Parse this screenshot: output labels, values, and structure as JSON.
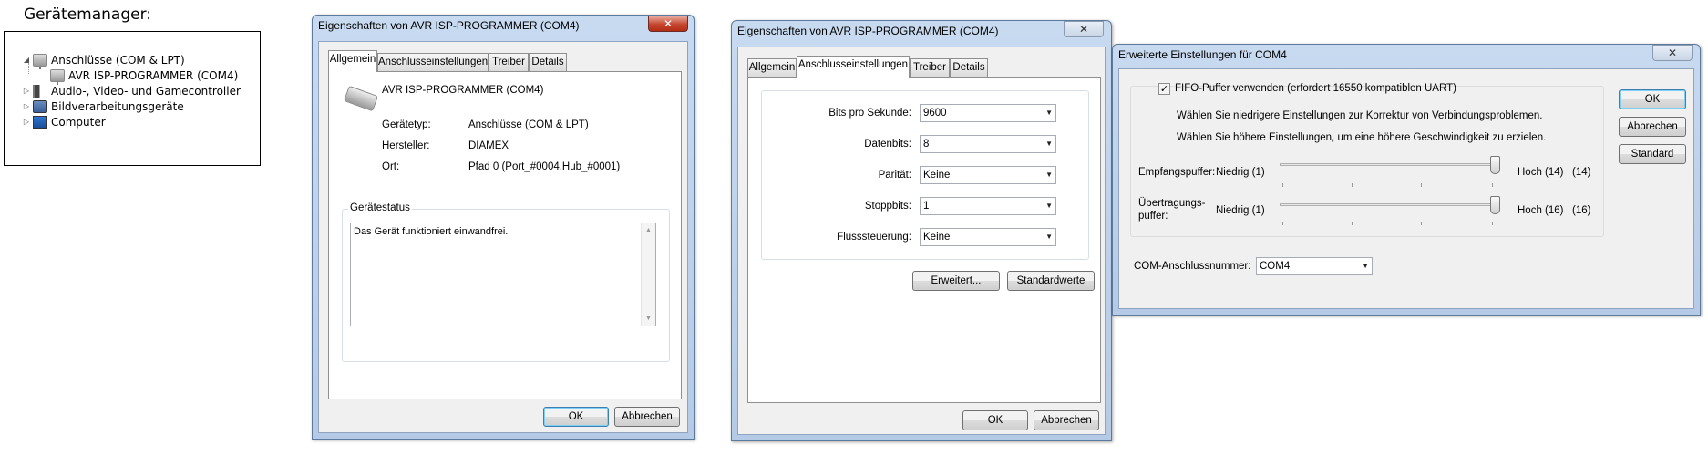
{
  "device_manager": {
    "heading": "Gerätemanager:",
    "tree": [
      {
        "label": "Anschlüsse (COM & LPT)",
        "expander": "◢",
        "icon": "port-icon"
      },
      {
        "label": "AVR ISP-PROGRAMMER (COM4)",
        "icon": "port-icon"
      },
      {
        "label": "Audio-, Video- und Gamecontroller",
        "expander": "▷",
        "icon": "speaker-icon"
      },
      {
        "label": "Bildverarbeitungsgeräte",
        "expander": "▷",
        "icon": "camera-icon"
      },
      {
        "label": "Computer",
        "expander": "▷",
        "icon": "computer-icon"
      }
    ]
  },
  "dialog_general": {
    "title": "Eigenschaften von AVR ISP-PROGRAMMER (COM4)",
    "close": "✕",
    "tabs": [
      "Allgemein",
      "Anschlusseinstellungen",
      "Treiber",
      "Details"
    ],
    "device_name": "AVR ISP-PROGRAMMER (COM4)",
    "properties": [
      {
        "label": "Gerätetyp:",
        "value": "Anschlüsse (COM & LPT)"
      },
      {
        "label": "Hersteller:",
        "value": "DIAMEX"
      },
      {
        "label": "Ort:",
        "value": "Pfad 0 (Port_#0004.Hub_#0001)"
      }
    ],
    "status_group": "Gerätestatus",
    "status_text": "Das Gerät funktioniert einwandfrei.",
    "ok": "OK",
    "cancel": "Abbrechen"
  },
  "dialog_port": {
    "title": "Eigenschaften von AVR ISP-PROGRAMMER (COM4)",
    "close": "✕",
    "tabs": [
      "Allgemein",
      "Anschlusseinstellungen",
      "Treiber",
      "Details"
    ],
    "settings": [
      {
        "label": "Bits pro Sekunde:",
        "value": "9600"
      },
      {
        "label": "Datenbits:",
        "value": "8"
      },
      {
        "label": "Parität:",
        "value": "Keine"
      },
      {
        "label": "Stoppbits:",
        "value": "1"
      },
      {
        "label": "Flusssteuerung:",
        "value": "Keine"
      }
    ],
    "advanced": "Erweitert...",
    "defaults": "Standardwerte",
    "ok": "OK",
    "cancel": "Abbrechen"
  },
  "dialog_advanced": {
    "title": "Erweiterte Einstellungen für COM4",
    "close": "✕",
    "fifo_checked": true,
    "fifo_label": "FIFO-Puffer verwenden (erfordert 16550 kompatiblen UART)",
    "hint_low": "Wählen Sie niedrigere Einstellungen zur Korrektur von Verbindungsproblemen.",
    "hint_high": "Wählen Sie höhere Einstellungen, um eine höhere Geschwindigkeit zu erzielen.",
    "receive": {
      "label": "Empfangspuffer:",
      "low": "Niedrig (1)",
      "high": "Hoch (14)",
      "value": "(14)",
      "level": 1.0
    },
    "transmit": {
      "label1": "Übertragungs-",
      "label2": "puffer:",
      "low": "Niedrig (1)",
      "high": "Hoch (16)",
      "value": "(16)",
      "level": 1.0
    },
    "com_label": "COM-Anschlussnummer:",
    "com_value": "COM4",
    "ok": "OK",
    "cancel": "Abbrechen",
    "standard": "Standard"
  }
}
